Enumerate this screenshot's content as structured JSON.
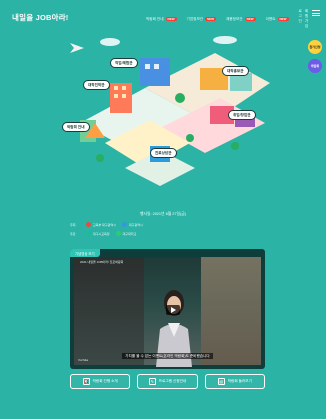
{
  "brand": {
    "logo_text": "내일을 JOB아라!"
  },
  "topnav": {
    "items": [
      {
        "label": "박람회 안내",
        "new_badge": "NEW"
      },
      {
        "label": "기업정보관",
        "new_badge": "NEW"
      },
      {
        "label": "채용정보관",
        "new_badge": "NEW"
      },
      {
        "label": "이벤트",
        "new_badge": "NEW"
      }
    ],
    "util": [
      "로그인",
      "회원가입"
    ]
  },
  "side_badges": [
    {
      "label": "참가신청",
      "color": "#ffd23b"
    },
    {
      "label": "박람회",
      "color": "#6c5ce7"
    }
  ],
  "zones": [
    {
      "label": "직업/체험관"
    },
    {
      "label": "대학진학관"
    },
    {
      "label": "대학홍보관"
    },
    {
      "label": "박람회 안내"
    },
    {
      "label": "취업/창업관"
    },
    {
      "label": "진로상담관"
    }
  ],
  "event": {
    "date_line": "행사일: 2021년 8월 27일(금)",
    "host_label": "주최",
    "organizer_label": "주관",
    "hosts": [
      "교육부 대구광역시",
      "대구광역시"
    ],
    "organizers": [
      "대구시교육청",
      "대구대학교"
    ]
  },
  "video": {
    "tab_label": "기념영상 보기",
    "title": "2021 내일을 JOB아라! 진로박람회",
    "subtitle": "가치를 볼 수 있는 이벤트(온라인 박람회)도 준비했습니다",
    "source": "YouTube"
  },
  "buttons": [
    {
      "label": "박람회 진행 소개",
      "icon": "megaphone-icon"
    },
    {
      "label": "프로그램 신청안내",
      "icon": "edit-icon"
    },
    {
      "label": "박람회 둘러보기",
      "icon": "document-icon"
    }
  ],
  "colors": {
    "background": "#2bb3a5",
    "accent": "#ffd23b"
  }
}
